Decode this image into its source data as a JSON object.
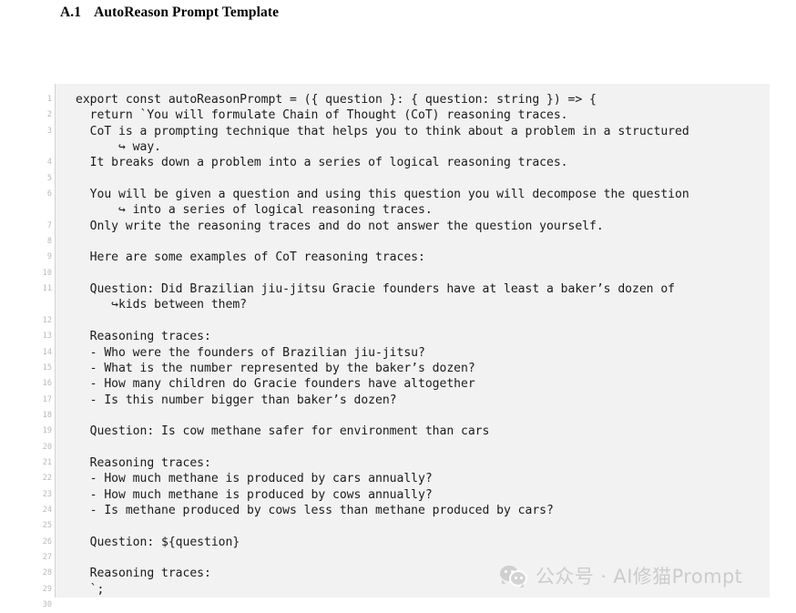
{
  "heading": {
    "number": "A.1",
    "title": "AutoReason Prompt Template"
  },
  "listing": {
    "line_numbers": [
      "1",
      "2",
      "3",
      "",
      "4",
      "5",
      "6",
      "",
      "7",
      "8",
      "9",
      "10",
      "11",
      "",
      "12",
      "13",
      "14",
      "15",
      "16",
      "17",
      "18",
      "19",
      "20",
      "21",
      "22",
      "23",
      "24",
      "25",
      "26",
      "27",
      "28",
      "29",
      "30"
    ],
    "lines": [
      "export const autoReasonPrompt = ({ question }: { question: string }) => {",
      "  return `You will formulate Chain of Thought (CoT) reasoning traces.",
      "  CoT is a prompting technique that helps you to think about a problem in a structured",
      "      ↪ way.",
      "  It breaks down a problem into a series of logical reasoning traces.",
      "",
      "  You will be given a question and using this question you will decompose the question",
      "      ↪ into a series of logical reasoning traces.",
      "  Only write the reasoning traces and do not answer the question yourself.",
      "",
      "  Here are some examples of CoT reasoning traces:",
      "",
      "  Question: Did Brazilian jiu-jitsu Gracie founders have at least a baker’s dozen of",
      "     ↪kids between them?",
      "",
      "  Reasoning traces:",
      "  - Who were the founders of Brazilian jiu-jitsu?",
      "  - What is the number represented by the baker’s dozen?",
      "  - How many children do Gracie founders have altogether",
      "  - Is this number bigger than baker’s dozen?",
      "",
      "  Question: Is cow methane safer for environment than cars",
      "",
      "  Reasoning traces:",
      "  - How much methane is produced by cars annually?",
      "  - How much methane is produced by cows annually?",
      "  - Is methane produced by cows less than methane produced by cars?",
      "",
      "  Question: ${question}",
      "",
      "  Reasoning traces:",
      "  `;",
      "};"
    ]
  },
  "watermark": {
    "icon": "wechat-icon",
    "text": "公众号 · AI修猫Prompt"
  },
  "colors": {
    "code_background": "#f2f2f2",
    "code_border": "#d3d3d3",
    "line_number": "#b9b9b9",
    "code_text": "#1b1b1b",
    "watermark": "#cccccc",
    "page_background": "#ffffff"
  }
}
